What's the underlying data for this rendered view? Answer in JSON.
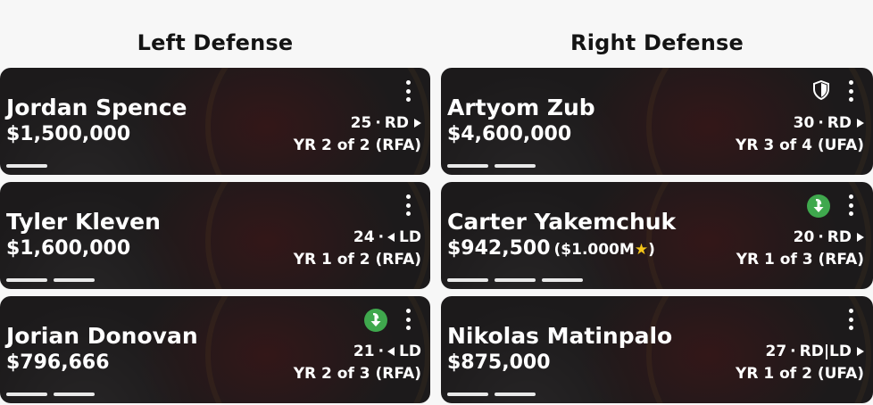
{
  "left": {
    "title": "Left Defense",
    "cards": [
      {
        "name": "Jordan Spence",
        "salary": "$1,500,000",
        "age": "25",
        "sep": "·",
        "pos": "RD",
        "contract": "YR 2 of 2 (RFA)",
        "bars": 1,
        "badge": ""
      },
      {
        "name": "Tyler Kleven",
        "salary": "$1,600,000",
        "age": "24",
        "sep": "·",
        "pos": "LD",
        "contract": "YR 1 of 2 (RFA)",
        "bars": 2,
        "badge": ""
      },
      {
        "name": "Jorian Donovan",
        "salary": "$796,666",
        "age": "21",
        "sep": "·",
        "pos": "LD",
        "contract": "YR 2 of 3 (RFA)",
        "bars": 2,
        "badge": "down-arrow-icon"
      }
    ]
  },
  "right": {
    "title": "Right Defense",
    "cards": [
      {
        "name": "Artyom Zub",
        "salary": "$4,600,000",
        "age": "30",
        "sep": "·",
        "pos": "RD",
        "contract": "YR 3 of 4 (UFA)",
        "bars": 2,
        "badge": "shield-icon"
      },
      {
        "name": "Carter Yakemchuk",
        "salary": "$942,500",
        "salary_extra": "($1.000M",
        "salary_extra_end": ")",
        "age": "20",
        "sep": "·",
        "pos": "RD",
        "contract": "YR 1 of 3 (RFA)",
        "bars": 3,
        "badge": "down-arrow-icon"
      },
      {
        "name": "Nikolas Matinpalo",
        "salary": "$875,000",
        "age": "27",
        "sep": "·",
        "pos": "RD|LD",
        "contract": "YR 1 of 2 (UFA)",
        "bars": 2,
        "badge": ""
      }
    ]
  },
  "colors": {
    "card_bg": "#1c1a1b",
    "badge_green": "#3fa84d",
    "star": "#f5c518"
  }
}
